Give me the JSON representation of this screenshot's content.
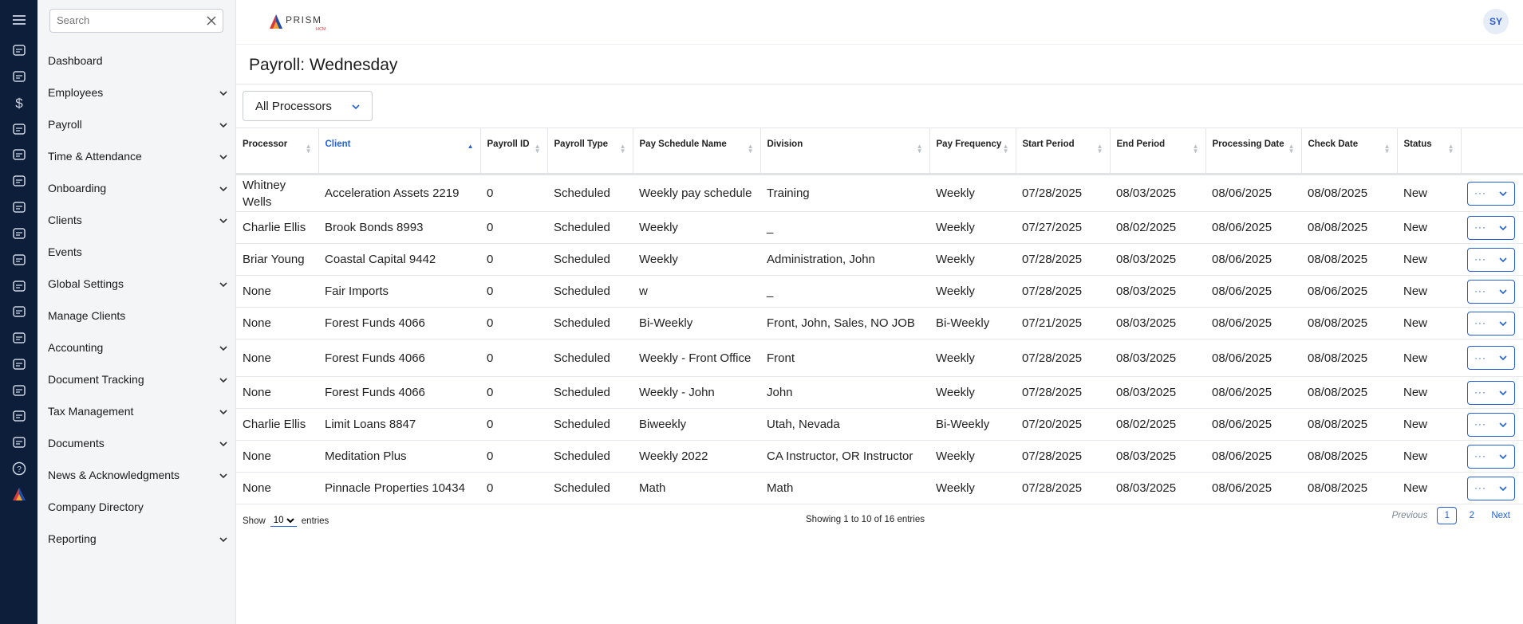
{
  "colors": {
    "accent": "#2360d8",
    "rail": "#0d1e3a",
    "sidebar": "#f4f5f7"
  },
  "rail_icons": [
    "menu-icon",
    "dashboard-gauge-icon",
    "employees-icon",
    "payroll-dollar-icon",
    "time-clock-icon",
    "onboarding-icon",
    "clients-icon",
    "events-calendar-icon",
    "global-settings-icon",
    "manage-clients-icon",
    "accounting-calculator-icon",
    "document-tracking-icon",
    "tax-management-icon",
    "documents-folder-icon",
    "news-icon",
    "company-directory-icon",
    "reporting-icon",
    "help-icon",
    "prism-logo-icon"
  ],
  "search": {
    "placeholder": "Search"
  },
  "nav": [
    {
      "label": "Dashboard",
      "expandable": false
    },
    {
      "label": "Employees",
      "expandable": true
    },
    {
      "label": "Payroll",
      "expandable": true
    },
    {
      "label": "Time & Attendance",
      "expandable": true
    },
    {
      "label": "Onboarding",
      "expandable": true
    },
    {
      "label": "Clients",
      "expandable": true
    },
    {
      "label": "Events",
      "expandable": false
    },
    {
      "label": "Global Settings",
      "expandable": true
    },
    {
      "label": "Manage Clients",
      "expandable": false
    },
    {
      "label": "Accounting",
      "expandable": true
    },
    {
      "label": "Document Tracking",
      "expandable": true
    },
    {
      "label": "Tax Management",
      "expandable": true
    },
    {
      "label": "Documents",
      "expandable": true
    },
    {
      "label": "News & Acknowledgments",
      "expandable": true
    },
    {
      "label": "Company Directory",
      "expandable": false
    },
    {
      "label": "Reporting",
      "expandable": true
    }
  ],
  "header": {
    "logo_text": "PRISM",
    "logo_sub": "HCM",
    "avatar_initials": "SY"
  },
  "page": {
    "title": "Payroll: Wednesday",
    "processor_filter": "All Processors"
  },
  "table": {
    "columns": [
      "Processor",
      "Client",
      "Payroll ID",
      "Payroll Type",
      "Pay Schedule Name",
      "Division",
      "Pay Frequency",
      "Start Period",
      "End Period",
      "Processing Date",
      "Check Date",
      "Status"
    ],
    "sorted_column": "Client",
    "action_label": "···",
    "rows": [
      [
        "Whitney Wells",
        "Acceleration Assets 2219",
        "0",
        "Scheduled",
        "Weekly pay schedule",
        "Training",
        "Weekly",
        "07/28/2025",
        "08/03/2025",
        "08/06/2025",
        "08/08/2025",
        "New"
      ],
      [
        "Charlie Ellis",
        "Brook Bonds 8993",
        "0",
        "Scheduled",
        "Weekly",
        "_",
        "Weekly",
        "07/27/2025",
        "08/02/2025",
        "08/06/2025",
        "08/08/2025",
        "New"
      ],
      [
        "Briar Young",
        "Coastal Capital 9442",
        "0",
        "Scheduled",
        "Weekly",
        "Administration, John",
        "Weekly",
        "07/28/2025",
        "08/03/2025",
        "08/06/2025",
        "08/08/2025",
        "New"
      ],
      [
        "None",
        "Fair Imports",
        "0",
        "Scheduled",
        "w",
        "_",
        "Weekly",
        "07/28/2025",
        "08/03/2025",
        "08/06/2025",
        "08/06/2025",
        "New"
      ],
      [
        "None",
        "Forest Funds 4066",
        "0",
        "Scheduled",
        "Bi-Weekly",
        "Front, John, Sales, NO JOB",
        "Bi-Weekly",
        "07/21/2025",
        "08/03/2025",
        "08/06/2025",
        "08/08/2025",
        "New"
      ],
      [
        "None",
        "Forest Funds 4066",
        "0",
        "Scheduled",
        "Weekly - Front Office",
        "Front",
        "Weekly",
        "07/28/2025",
        "08/03/2025",
        "08/06/2025",
        "08/08/2025",
        "New"
      ],
      [
        "None",
        "Forest Funds 4066",
        "0",
        "Scheduled",
        "Weekly - John",
        "John",
        "Weekly",
        "07/28/2025",
        "08/03/2025",
        "08/06/2025",
        "08/08/2025",
        "New"
      ],
      [
        "Charlie Ellis",
        "Limit Loans 8847",
        "0",
        "Scheduled",
        "Biweekly",
        "Utah, Nevada",
        "Bi-Weekly",
        "07/20/2025",
        "08/02/2025",
        "08/06/2025",
        "08/08/2025",
        "New"
      ],
      [
        "None",
        "Meditation Plus",
        "0",
        "Scheduled",
        "Weekly 2022",
        "CA Instructor, OR Instructor",
        "Weekly",
        "07/28/2025",
        "08/03/2025",
        "08/06/2025",
        "08/08/2025",
        "New"
      ],
      [
        "None",
        "Pinnacle Properties 10434",
        "0",
        "Scheduled",
        "Math",
        "Math",
        "Weekly",
        "07/28/2025",
        "08/03/2025",
        "08/06/2025",
        "08/08/2025",
        "New"
      ]
    ]
  },
  "footer": {
    "show_label": "Show",
    "entries_label": "entries",
    "page_size": "10",
    "info": "Showing 1 to 10 of 16 entries",
    "previous": "Previous",
    "next": "Next",
    "pages": [
      "1",
      "2"
    ],
    "current_page": "1"
  }
}
